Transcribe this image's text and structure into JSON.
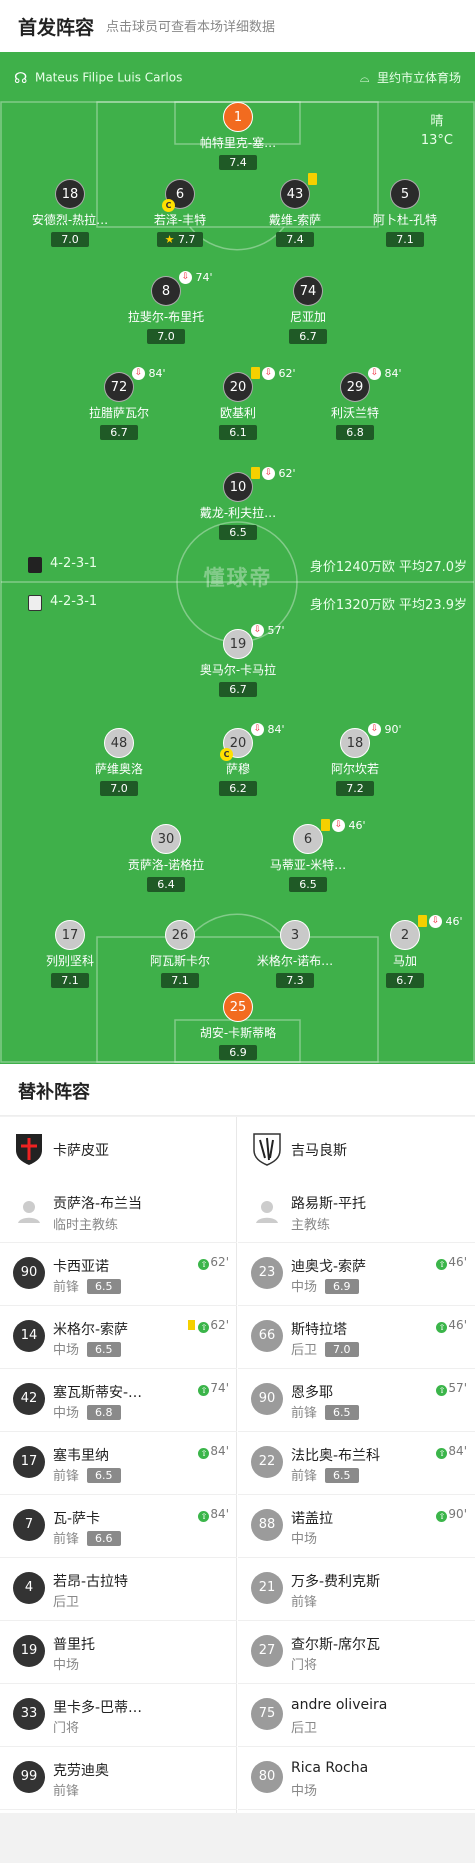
{
  "header": {
    "title": "首发阵容",
    "subtitle": "点击球员可查看本场详细数据"
  },
  "pitch_info": {
    "referee": "Mateus Filipe Luis Carlos",
    "venue": "里约市立体育场",
    "weather": "晴",
    "temperature": "13°C",
    "watermark": "懂球帝"
  },
  "home": {
    "formation": "4-2-3-1",
    "value_text": "身价1240万欧 平均27.0岁",
    "players": [
      {
        "num": "1",
        "name": "帕特里克-塞…",
        "rating": "7.4"
      },
      {
        "num": "18",
        "name": "安德烈-热拉…",
        "rating": "7.0"
      },
      {
        "num": "6",
        "name": "若泽-丰特",
        "rating": "7.7",
        "captain": "C",
        "mvp": "★"
      },
      {
        "num": "43",
        "name": "戴维-索萨",
        "rating": "7.4"
      },
      {
        "num": "5",
        "name": "阿卜杜-孔特",
        "rating": "7.1"
      },
      {
        "num": "8",
        "name": "拉斐尔-布里托",
        "rating": "7.0",
        "sub": "74'"
      },
      {
        "num": "74",
        "name": "尼亚加",
        "rating": "6.7"
      },
      {
        "num": "72",
        "name": "拉腊萨瓦尔",
        "rating": "6.7",
        "sub": "84'"
      },
      {
        "num": "20",
        "name": "欧基利",
        "rating": "6.1",
        "sub": "62'"
      },
      {
        "num": "29",
        "name": "利沃兰特",
        "rating": "6.8",
        "sub": "84'"
      },
      {
        "num": "10",
        "name": "戴龙-利夫拉…",
        "rating": "6.5",
        "sub": "62'"
      }
    ]
  },
  "away": {
    "formation": "4-2-3-1",
    "value_text": "身价1320万欧 平均23.9岁",
    "players": [
      {
        "num": "19",
        "name": "奥马尔-卡马拉",
        "rating": "6.7",
        "sub": "57'"
      },
      {
        "num": "48",
        "name": "萨维奥洛",
        "rating": "7.0"
      },
      {
        "num": "20",
        "name": "萨穆",
        "rating": "6.2",
        "sub": "84'",
        "captain": "C"
      },
      {
        "num": "18",
        "name": "阿尔坎若",
        "rating": "7.2",
        "sub": "90'"
      },
      {
        "num": "30",
        "name": "贡萨洛-诺格拉",
        "rating": "6.4"
      },
      {
        "num": "6",
        "name": "马蒂亚-米特…",
        "rating": "6.5",
        "sub": "46'"
      },
      {
        "num": "17",
        "name": "列别坚科",
        "rating": "7.1"
      },
      {
        "num": "26",
        "name": "阿瓦斯卡尔",
        "rating": "7.1"
      },
      {
        "num": "3",
        "name": "米格尔-诺布…",
        "rating": "7.3"
      },
      {
        "num": "2",
        "name": "马加",
        "rating": "6.7",
        "sub": "46'"
      },
      {
        "num": "25",
        "name": "胡安-卡斯蒂略",
        "rating": "6.9"
      }
    ]
  },
  "subs_title": "替补阵容",
  "bench": {
    "home_team": "卡萨皮亚",
    "away_team": "吉马良斯",
    "home_coach": {
      "name": "贡萨洛-布兰当",
      "role": "临时主教练"
    },
    "away_coach": {
      "name": "路易斯-平托",
      "role": "主教练"
    },
    "home": [
      {
        "num": "90",
        "name": "卡西亚诺",
        "pos": "前锋",
        "rating": "6.5",
        "in": "62'"
      },
      {
        "num": "14",
        "name": "米格尔-索萨",
        "pos": "中场",
        "rating": "6.5",
        "in": "62'",
        "yellow": true
      },
      {
        "num": "42",
        "name": "塞瓦斯蒂安-…",
        "pos": "中场",
        "rating": "6.8",
        "in": "74'"
      },
      {
        "num": "17",
        "name": "塞韦里纳",
        "pos": "前锋",
        "rating": "6.5",
        "in": "84'"
      },
      {
        "num": "7",
        "name": "瓦-萨卡",
        "pos": "前锋",
        "rating": "6.6",
        "in": "84'"
      },
      {
        "num": "4",
        "name": "若昂-古拉特",
        "pos": "后卫"
      },
      {
        "num": "19",
        "name": "普里托",
        "pos": "中场"
      },
      {
        "num": "33",
        "name": "里卡多-巴蒂…",
        "pos": "门将"
      },
      {
        "num": "99",
        "name": "克劳迪奥",
        "pos": "前锋"
      }
    ],
    "away": [
      {
        "num": "23",
        "name": "迪奥戈-索萨",
        "pos": "中场",
        "rating": "6.9",
        "in": "46'"
      },
      {
        "num": "66",
        "name": "斯特拉塔",
        "pos": "后卫",
        "rating": "7.0",
        "in": "46'"
      },
      {
        "num": "90",
        "name": "恩多耶",
        "pos": "前锋",
        "rating": "6.5",
        "in": "57'"
      },
      {
        "num": "22",
        "name": "法比奥-布兰科",
        "pos": "前锋",
        "rating": "6.5",
        "in": "84'"
      },
      {
        "num": "88",
        "name": "诺盖拉",
        "pos": "中场",
        "in": "90'"
      },
      {
        "num": "21",
        "name": "万多-费利克斯",
        "pos": "前锋"
      },
      {
        "num": "27",
        "name": "查尔斯-席尔瓦",
        "pos": "门将"
      },
      {
        "num": "75",
        "name": "andre oliveira",
        "pos": "后卫"
      },
      {
        "num": "80",
        "name": "Rica Rocha",
        "pos": "中场"
      }
    ]
  }
}
